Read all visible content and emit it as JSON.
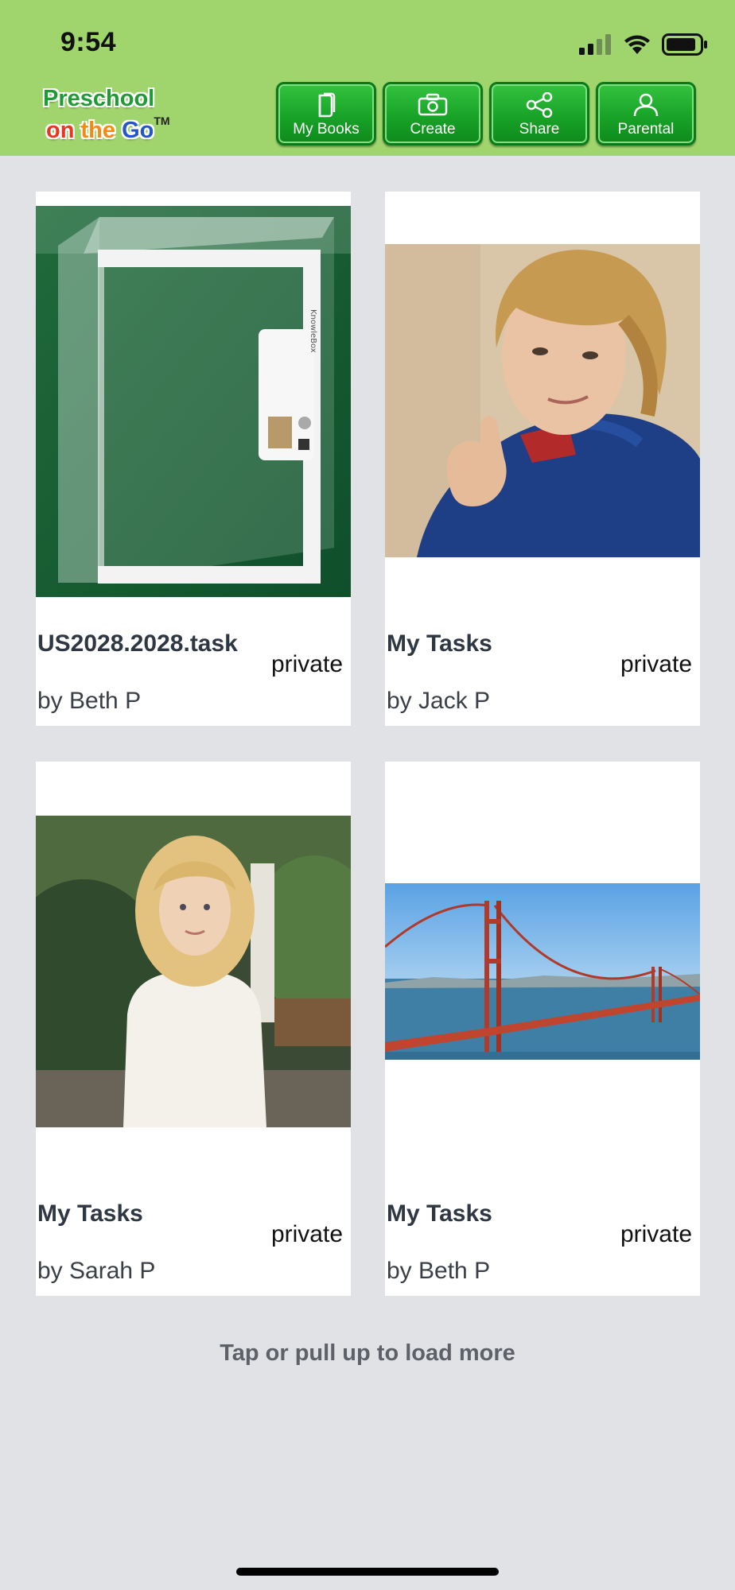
{
  "status_bar": {
    "time": "9:54"
  },
  "logo": {
    "line1": "Preschool",
    "on": "on",
    "the": "the",
    "go": "Go",
    "tm": "TM"
  },
  "nav": {
    "my_books": "My Books",
    "create": "Create",
    "share": "Share",
    "parental": "Parental"
  },
  "cards": [
    {
      "title": "US2028.2028.task",
      "privacy": "private",
      "author": "by Beth P",
      "image": "acrylic-box-photo"
    },
    {
      "title": "My Tasks",
      "privacy": "private",
      "author": "by Jack P",
      "image": "boy-thumbs-up-photo"
    },
    {
      "title": "My Tasks",
      "privacy": "private",
      "author": "by Sarah P",
      "image": "girl-garden-photo"
    },
    {
      "title": "My Tasks",
      "privacy": "private",
      "author": "by Beth P",
      "image": "golden-gate-bridge-photo"
    }
  ],
  "load_more": "Tap or pull up to load more",
  "colors": {
    "header_bg": "#a0d46c",
    "button_green": "#18a328",
    "page_bg": "#e1e2e6"
  }
}
